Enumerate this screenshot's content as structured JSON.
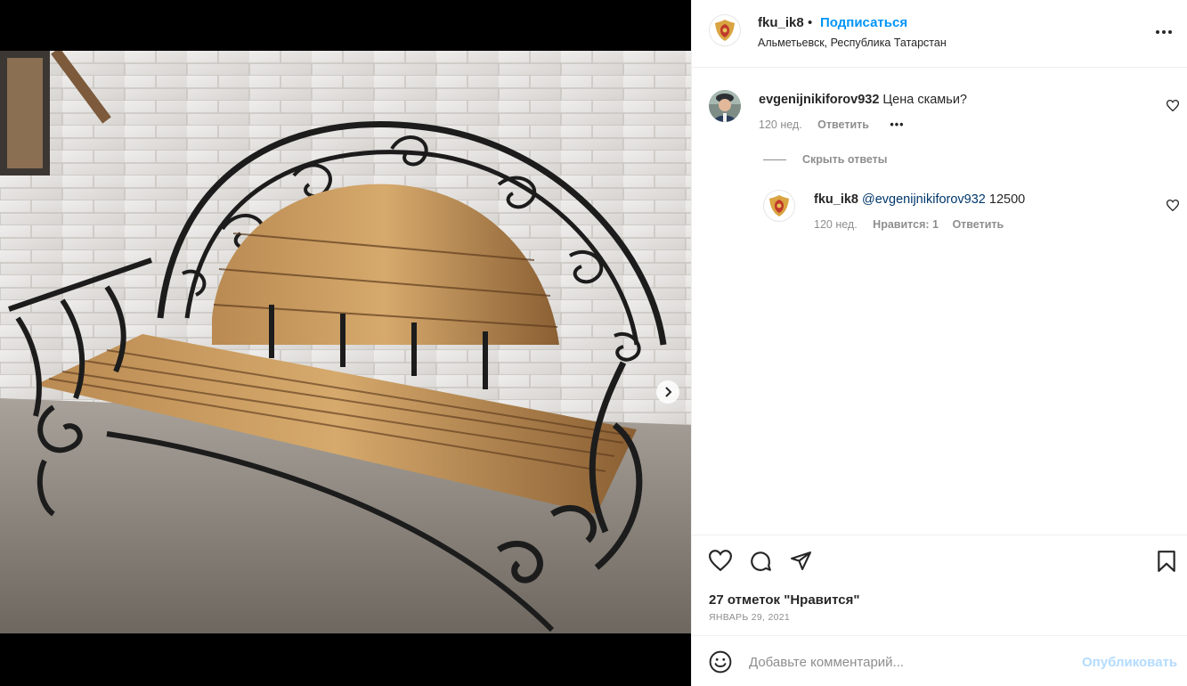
{
  "post": {
    "image_alt": "wrought iron bench with wooden seat",
    "carousel_total": 2,
    "carousel_active": 1
  },
  "header": {
    "username": "fku_ik8",
    "separator": "•",
    "follow_label": "Подписаться",
    "location": "Альметьевск, Республика Татарстан"
  },
  "comments": [
    {
      "username": "evgenijnikiforov932",
      "text": "Цена скамьи?",
      "age": "120 нед.",
      "reply_label": "Ответить",
      "more": "•••"
    }
  ],
  "hide_replies_label": "Скрыть ответы",
  "replies": [
    {
      "username": "fku_ik8",
      "mention": "@evgenijnikiforov932",
      "text": "12500",
      "age": "120 нед.",
      "likes_label": "Нравится: 1",
      "reply_label": "Ответить"
    }
  ],
  "actions": {
    "likes_text": "27 отметок \"Нравится\"",
    "date": "ЯНВАРЬ 29, 2021"
  },
  "composer": {
    "placeholder": "Добавьте комментарий...",
    "post_label": "Опубликовать"
  },
  "colors": {
    "accent": "#0095f6",
    "post_disabled": "#b3dbff",
    "muted": "#8e8e8e"
  }
}
